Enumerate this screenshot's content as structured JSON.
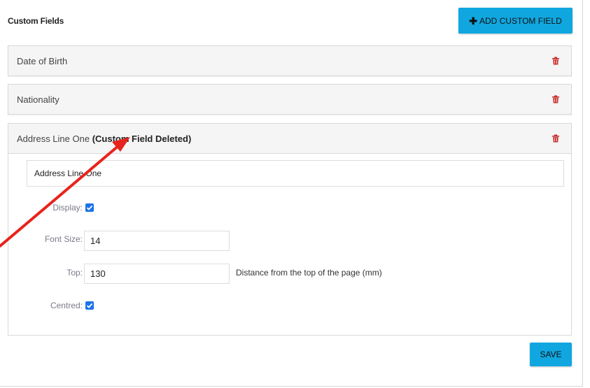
{
  "section": {
    "title": "Custom Fields",
    "add_button_label": "ADD CUSTOM FIELD",
    "add_button_icon": "plus-icon"
  },
  "fields": [
    {
      "label": "Date of Birth",
      "icon": "trash-icon"
    },
    {
      "label": "Nationality",
      "icon": "trash-icon"
    }
  ],
  "expanded_field": {
    "label": "Address Line One",
    "deleted_tag": "(Custom Field Deleted)",
    "icon": "trash-icon",
    "name_value": "Address Line One",
    "display_label": "Display:",
    "display_checked": true,
    "font_size_label": "Font Size:",
    "font_size_value": "14",
    "top_label": "Top:",
    "top_value": "130",
    "top_hint": "Distance from the top of the page (mm)",
    "centred_label": "Centred:",
    "centred_checked": true
  },
  "save_label": "SAVE",
  "colors": {
    "accent": "#10a7e0",
    "trash": "#c62828",
    "checkbox": "#1a73e8",
    "annotation_arrow": "#e8231b"
  }
}
